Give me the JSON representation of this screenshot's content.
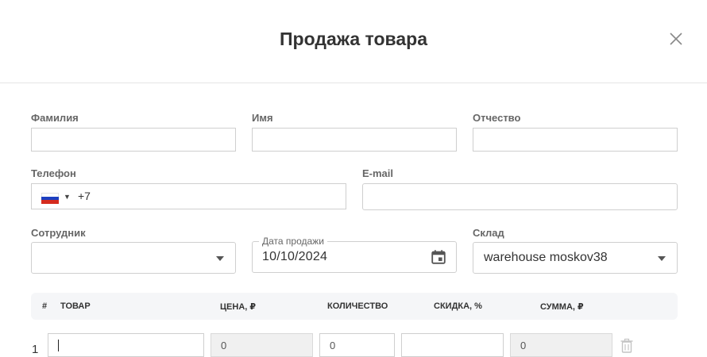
{
  "dialog": {
    "title": "Продажа товара"
  },
  "form": {
    "last_name_label": "Фамилия",
    "first_name_label": "Имя",
    "patronymic_label": "Отчество",
    "phone_label": "Телефон",
    "phone_code": "+7",
    "phone_country_flag": "russia-flag-icon",
    "email_label": "E-mail",
    "employee_label": "Сотрудник",
    "sale_date_label": "Дата продажи",
    "sale_date_value": "10/10/2024",
    "warehouse_label": "Склад",
    "warehouse_value": "warehouse moskov38"
  },
  "table": {
    "headers": [
      "#",
      "ТОВАР",
      "ЦЕНА, ₽",
      "КОЛИЧЕСТВО",
      "СКИДКА, %",
      "СУММА, ₽"
    ],
    "rows": [
      {
        "num": "1",
        "product": "",
        "price": "0",
        "quantity": "0",
        "discount": "",
        "sum": "0"
      }
    ]
  },
  "colors": {
    "border": "#cfcfcf",
    "header_bg": "#f5f6f8",
    "readonly_bg": "#f0f0f0"
  }
}
